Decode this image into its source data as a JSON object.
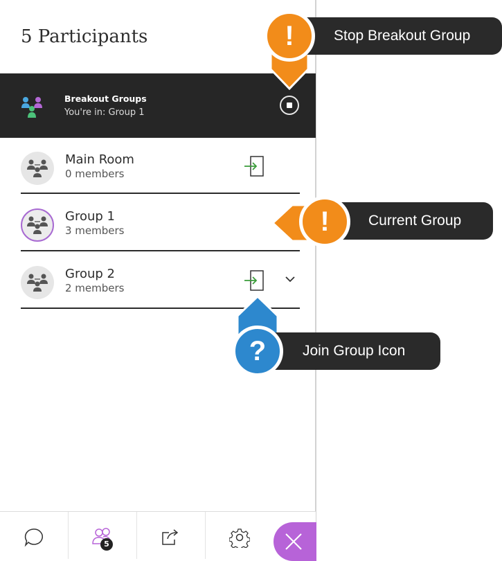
{
  "panel": {
    "title": "5 Participants"
  },
  "breakout_bar": {
    "title": "Breakout Groups",
    "subtitle": "You're in: Group 1",
    "stop_icon": "stop-circle-icon"
  },
  "groups": [
    {
      "name": "Main Room",
      "members": "0 members",
      "current": false,
      "join_icon": "join-group-icon"
    },
    {
      "name": "Group 1",
      "members": "3 members",
      "current": true
    },
    {
      "name": "Group 2",
      "members": "2 members",
      "current": false,
      "join_icon": "join-group-icon",
      "expand_icon": "chevron-down-icon"
    }
  ],
  "toolbar": {
    "items": [
      {
        "icon": "chat-icon"
      },
      {
        "icon": "participants-icon",
        "badge": "5"
      },
      {
        "icon": "share-content-icon"
      },
      {
        "icon": "settings-gear-icon"
      }
    ],
    "close_icon": "close-icon"
  },
  "callouts": [
    {
      "label": "Stop Breakout Group",
      "glyph": "!",
      "color": "#f28c1a"
    },
    {
      "label": "Current Group",
      "glyph": "!",
      "color": "#f28c1a"
    },
    {
      "label": "Join Group Icon",
      "glyph": "?",
      "color": "#2d88ce"
    }
  ],
  "colors": {
    "accent_purple": "#b763d8",
    "dark_bar": "#262626",
    "join_green": "#3a9c3a"
  }
}
